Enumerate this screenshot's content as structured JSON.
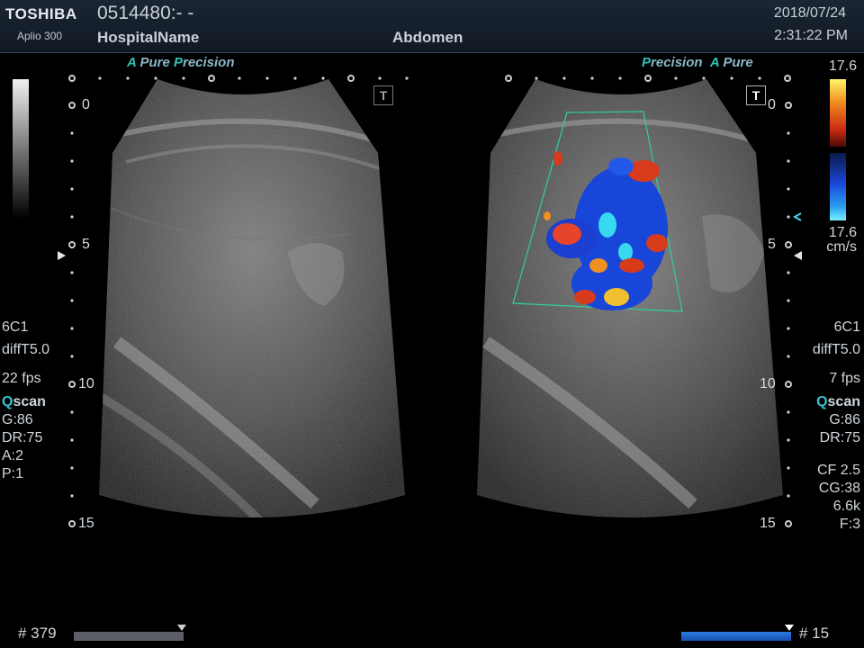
{
  "header": {
    "brand": "TOSHIBA",
    "model": "Aplio 300",
    "patient_id": "0514480:- -",
    "hospital": "HospitalName",
    "exam": "Abdomen",
    "date": "2018/07/24",
    "time": "2:31:22 PM"
  },
  "left_pane": {
    "apure_a": "A",
    "apure_pure": " Pure ",
    "apure_p": "P",
    "apure_precision": "recision",
    "t_label": "T",
    "depth_0": "0",
    "depth_5": "5",
    "depth_10": "10",
    "depth_15": "15",
    "probe": "6C1",
    "filter": "diffT5.0",
    "fps": "22 fps",
    "qscan_q": "Q",
    "qscan_rest": "scan",
    "gain": "G:86",
    "dr": "DR:75",
    "a": "A:2",
    "p": "P:1",
    "frame": "# 379"
  },
  "right_pane": {
    "precision_p": "P",
    "precision_rest": "recision",
    "apure_a": "A",
    "apure_pure": " Pure",
    "t_label": "T",
    "depth_0": "0",
    "depth_5": "5",
    "depth_10": "10",
    "depth_15": "15",
    "probe": "6C1",
    "filter": "diffT5.0",
    "fps": "7 fps",
    "qscan_q": "Q",
    "qscan_rest": "scan",
    "gain": "G:86",
    "dr": "DR:75",
    "cf": "CF 2.5",
    "cg": "CG:38",
    "prf": "6.6k",
    "f": "F:3",
    "frame": "# 15",
    "scale_top": "17.6",
    "scale_bottom": "17.6",
    "scale_unit": "cm/s"
  },
  "colors": {
    "doppler_red": "#d83a1c",
    "doppler_blue": "#1846d8",
    "roi_box": "#2fd0a0",
    "accent": "#2fc2b3"
  }
}
